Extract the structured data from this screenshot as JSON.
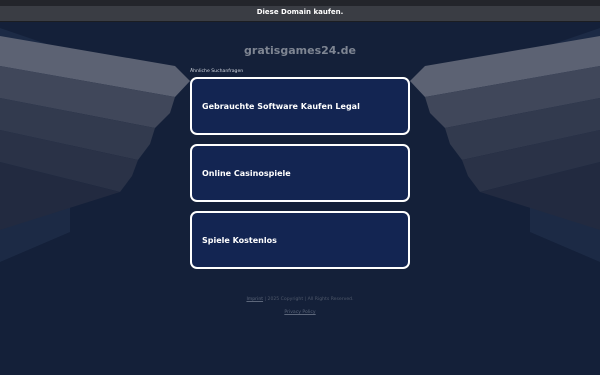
{
  "topbar": {
    "link_label": "Diese Domain kaufen."
  },
  "domain_title": "gratisgames24.de",
  "related_label": "Ähnliche Suchanfragen",
  "links": [
    {
      "label": "Gebrauchte Software Kaufen Legal"
    },
    {
      "label": "Online Casinospiele"
    },
    {
      "label": "Spiele Kostenlos"
    }
  ],
  "footer": {
    "imprint_label": "Imprint",
    "copyright_text": " | 2025 Copyright | All Rights Reserved.",
    "privacy_label": "Privacy Policy"
  },
  "colors": {
    "background": "#142039",
    "tile_fill": "#132552",
    "tile_border": "#ffffff",
    "topbar": "#3a3d44"
  }
}
